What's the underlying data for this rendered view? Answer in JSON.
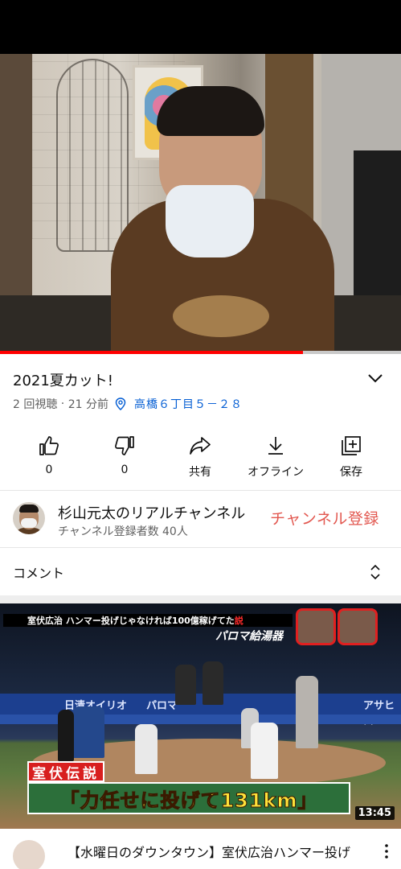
{
  "video": {
    "title": "2021夏カット!",
    "views": "2 回視聴",
    "age": "21 分前",
    "location": "高橋６丁目５－２８",
    "progress_fraction": 0.755
  },
  "actions": [
    {
      "icon": "thumbs-up-icon",
      "label": "0"
    },
    {
      "icon": "thumbs-down-icon",
      "label": "0"
    },
    {
      "icon": "share-icon",
      "label": "共有"
    },
    {
      "icon": "download-icon",
      "label": "オフライン"
    },
    {
      "icon": "add-to-playlist-icon",
      "label": "保存"
    }
  ],
  "channel": {
    "name": "杉山元太のリアルチャンネル",
    "subscribers": "チャンネル登録者数 40人",
    "subscribe_label": "チャンネル登録"
  },
  "comments": {
    "label": "コメント"
  },
  "recommended": {
    "thumb_banner_prefix": "室伏広治 ハンマー投げじゃなければ100億稼げてた",
    "thumb_banner_mark": "説",
    "thumb_sponsor": "パロマ給湯器",
    "thumb_wall_left": "日清オイリオ",
    "thumb_wall_mid": "パロマ",
    "thumb_wall_right": "アサヒスー",
    "thumb_legend": "室伏伝説",
    "thumb_caption": "「力任せに投げて131km」",
    "duration": "13:45",
    "title": "【水曜日のダウンタウン】室伏広治ハンマー投げ"
  },
  "colors": {
    "progress": "#ff0000",
    "subscribe": "#e2574f",
    "link": "#065fd4"
  }
}
